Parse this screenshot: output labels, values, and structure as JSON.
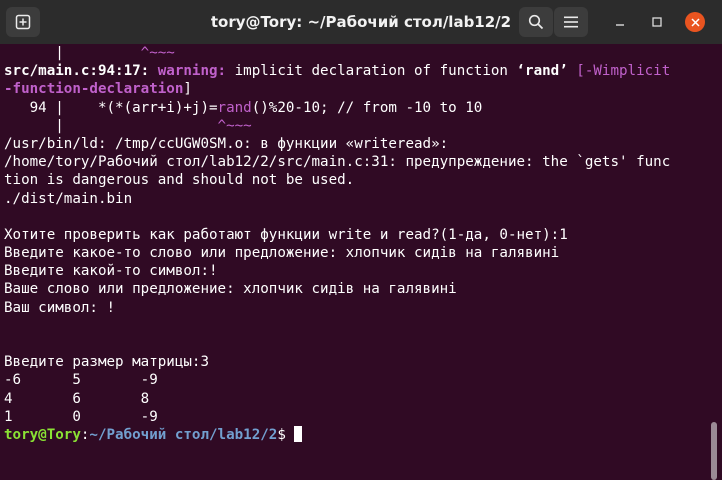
{
  "window": {
    "title": "tory@Tory: ~/Рабочий стол/lab12/2"
  },
  "icons": {
    "new_tab": "new-tab-icon",
    "search": "search-icon",
    "menu": "hamburger-menu-icon",
    "minimize": "minimize-icon",
    "maximize": "maximize-icon",
    "close": "close-icon"
  },
  "colors": {
    "background": "#300a24",
    "warning": "#c061cb",
    "prompt_user": "#8ae234",
    "prompt_path": "#729fcf",
    "close_button": "#e95420"
  },
  "terminal": {
    "l1": {
      "bar": "      |",
      "caret": "         ^~~~"
    },
    "l2": {
      "loc": "src/main.c:94:17: ",
      "warn": "warning: ",
      "msg": "implicit declaration of function ",
      "fn": "‘rand’",
      "sp": " ",
      "flag": "[-Wimplicit"
    },
    "l3": {
      "flag_cont": "-function-declaration",
      "close": "]"
    },
    "l4": {
      "pre": "   94 |    *(*(arr+i)+j)=",
      "rand": "rand",
      "post": "()%20-10; // from -10 to 10"
    },
    "l5": {
      "bar": "      |",
      "caret": "                  ^~~~"
    },
    "l6": "/usr/bin/ld: /tmp/ccUGW0SM.o: в функции «writeread»:",
    "l7": "/home/tory/Рабочий стол/lab12/2/src/main.c:31: предупреждение: the `gets' func",
    "l8": "tion is dangerous and should not be used.",
    "l9": "./dist/main.bin",
    "l10": "",
    "l11": "Хотите проверить как работают функции write и read?(1-да, 0-нет):1",
    "l12": "Введите какое-то слово или предложение: хлопчик сидів на галявині",
    "l13": "Введите какой-то символ:!",
    "l14": "Ваше слово или предложение: хлопчик сидів на галявині",
    "l15": "Ваш символ: !",
    "l16": "",
    "l17": "",
    "l18": "Введите размер матрицы:3",
    "l19": "-6      5       -9",
    "l20": "4       6       8",
    "l21": "1       0       -9",
    "prompt": {
      "user": "tory@Tory",
      "sep": ":",
      "path": "~/Рабочий стол/lab12/2",
      "sign": "$ "
    }
  }
}
